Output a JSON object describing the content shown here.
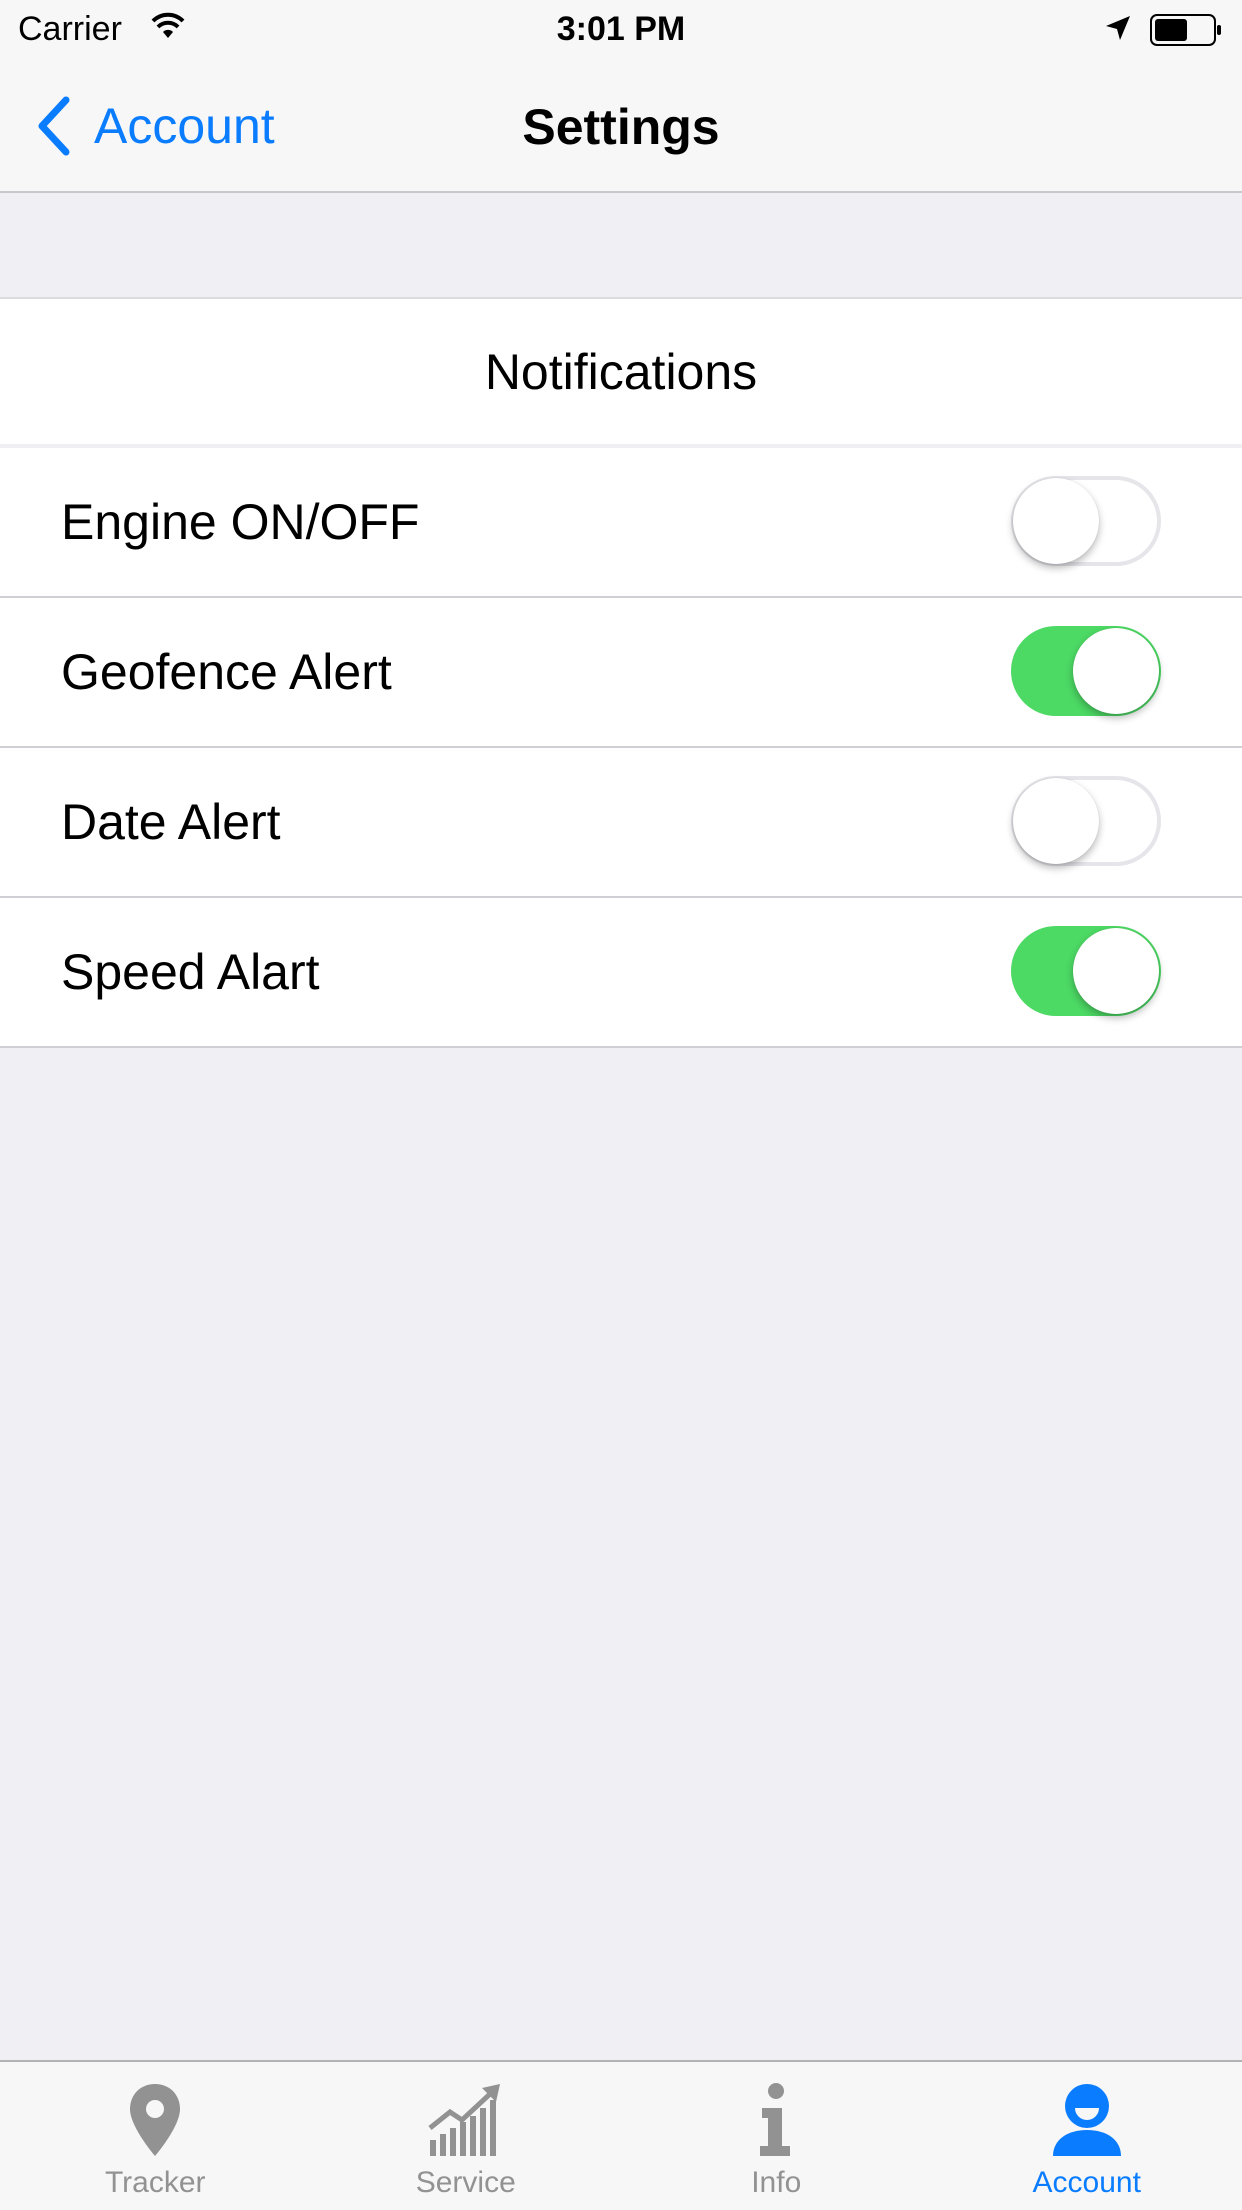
{
  "status_bar": {
    "carrier": "Carrier",
    "time": "3:01 PM"
  },
  "nav": {
    "back_label": "Account",
    "title": "Settings"
  },
  "section": {
    "title": "Notifications"
  },
  "settings": [
    {
      "label": "Engine ON/OFF",
      "enabled": false
    },
    {
      "label": "Geofence Alert",
      "enabled": true
    },
    {
      "label": "Date Alert",
      "enabled": false
    },
    {
      "label": "Speed Alart",
      "enabled": true
    }
  ],
  "tabs": [
    {
      "label": "Tracker",
      "icon": "location-pin-icon",
      "active": false
    },
    {
      "label": "Service",
      "icon": "chart-growth-icon",
      "active": false
    },
    {
      "label": "Info",
      "icon": "info-icon",
      "active": false
    },
    {
      "label": "Account",
      "icon": "user-icon",
      "active": true
    }
  ],
  "colors": {
    "accent": "#0a7cff",
    "toggle_on": "#4cd964",
    "tab_inactive": "#929292"
  }
}
